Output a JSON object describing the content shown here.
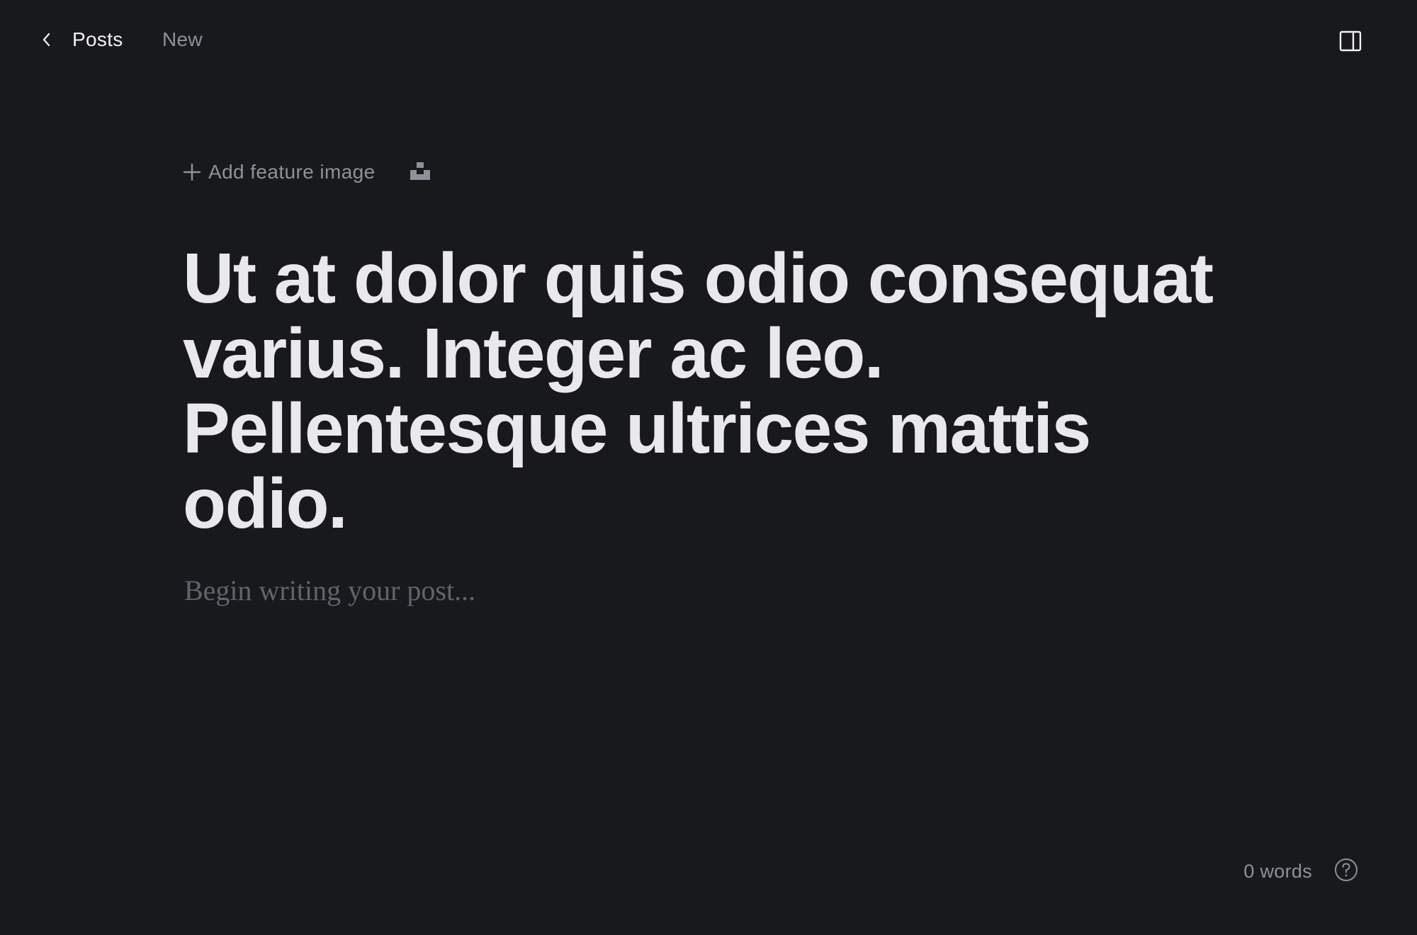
{
  "topbar": {
    "back_label": "Posts",
    "status": "New",
    "back_icon": "chevron-left-icon",
    "sidebar_icon": "sidebar-panel-icon"
  },
  "editor": {
    "add_feature_image": "Add feature image",
    "add_icon": "plus-icon",
    "unsplash_icon": "unsplash-icon",
    "title": "Ut at dolor quis odio consequat varius. Integer ac leo. Pellentesque ultrices mattis odio.",
    "body_placeholder": "Begin writing your post..."
  },
  "footer": {
    "word_count": "0 words",
    "help_icon": "question-circle-icon"
  },
  "colors": {
    "background": "#18191d",
    "title": "#e9e9ec",
    "muted": "#8e9198",
    "placeholder": "#60646d"
  }
}
